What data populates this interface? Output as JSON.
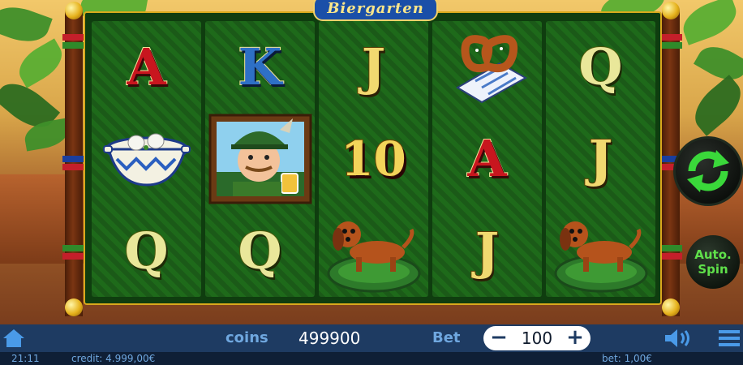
{
  "game": {
    "logo_text": "Biergarten",
    "reels": [
      [
        "A",
        "soup-bowl",
        "Q"
      ],
      [
        "K",
        "bavarian-man-portrait",
        "Q"
      ],
      [
        "J",
        "10",
        "dachshund"
      ],
      [
        "pretzel",
        "A",
        "J"
      ],
      [
        "Q",
        "J",
        "dachshund"
      ]
    ],
    "symbols_text": {
      "r0c0": "A",
      "r0c2": "Q",
      "r1c0": "K",
      "r1c2": "Q",
      "r2c0": "J",
      "r2c1": "10",
      "r3c1": "A",
      "r3c2": "J",
      "r4c0": "Q",
      "r4c1": "J"
    },
    "auto_spin_label": "Auto.\nSpin",
    "colors": {
      "accent": "#5fe04a",
      "bar": "#1e3b62",
      "label": "#6fa7df"
    }
  },
  "bottom_bar": {
    "coins_label": "coins",
    "coins_value": "499900",
    "bet_label": "Bet",
    "bet_value": "100",
    "minus": "−",
    "plus": "+"
  },
  "status_bar": {
    "time": "21:11",
    "credit": "credit: 4.999,00€",
    "bet": "bet: 1,00€"
  },
  "icons": [
    "home-icon",
    "speaker-icon",
    "menu-icon",
    "spin-arrows-icon"
  ]
}
